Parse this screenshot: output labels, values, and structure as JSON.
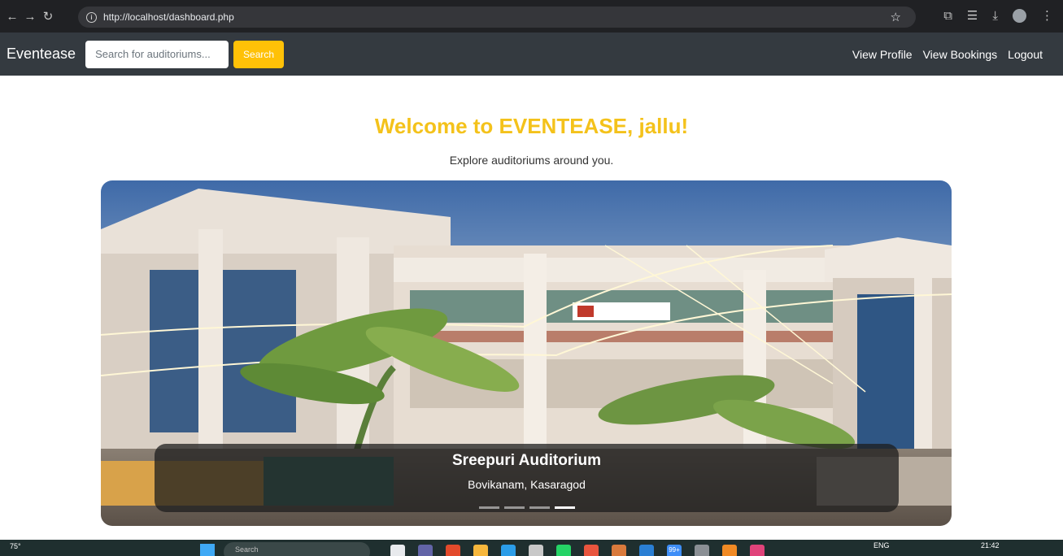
{
  "browser": {
    "url": "http://localhost/dashboard.php"
  },
  "navbar": {
    "brand": "Eventease",
    "search_placeholder": "Search for auditoriums...",
    "search_button": "Search",
    "links": [
      "View Profile",
      "View Bookings",
      "Logout"
    ]
  },
  "main": {
    "welcome": "Welcome to EVENTEASE, jallu!",
    "subtitle": "Explore auditoriums around you."
  },
  "carousel": {
    "caption_title": "Sreepuri Auditorium",
    "caption_location": "Bovikanam, Kasaragod",
    "slide_count": 4,
    "active_index": 3
  },
  "taskbar": {
    "weather": "75°",
    "search": "Search",
    "lang": "ENG",
    "time": "21:42",
    "badge": "99+"
  },
  "colors": {
    "accent": "#ffc107",
    "heading": "#f4c21b",
    "navbar_bg": "#343a40"
  }
}
